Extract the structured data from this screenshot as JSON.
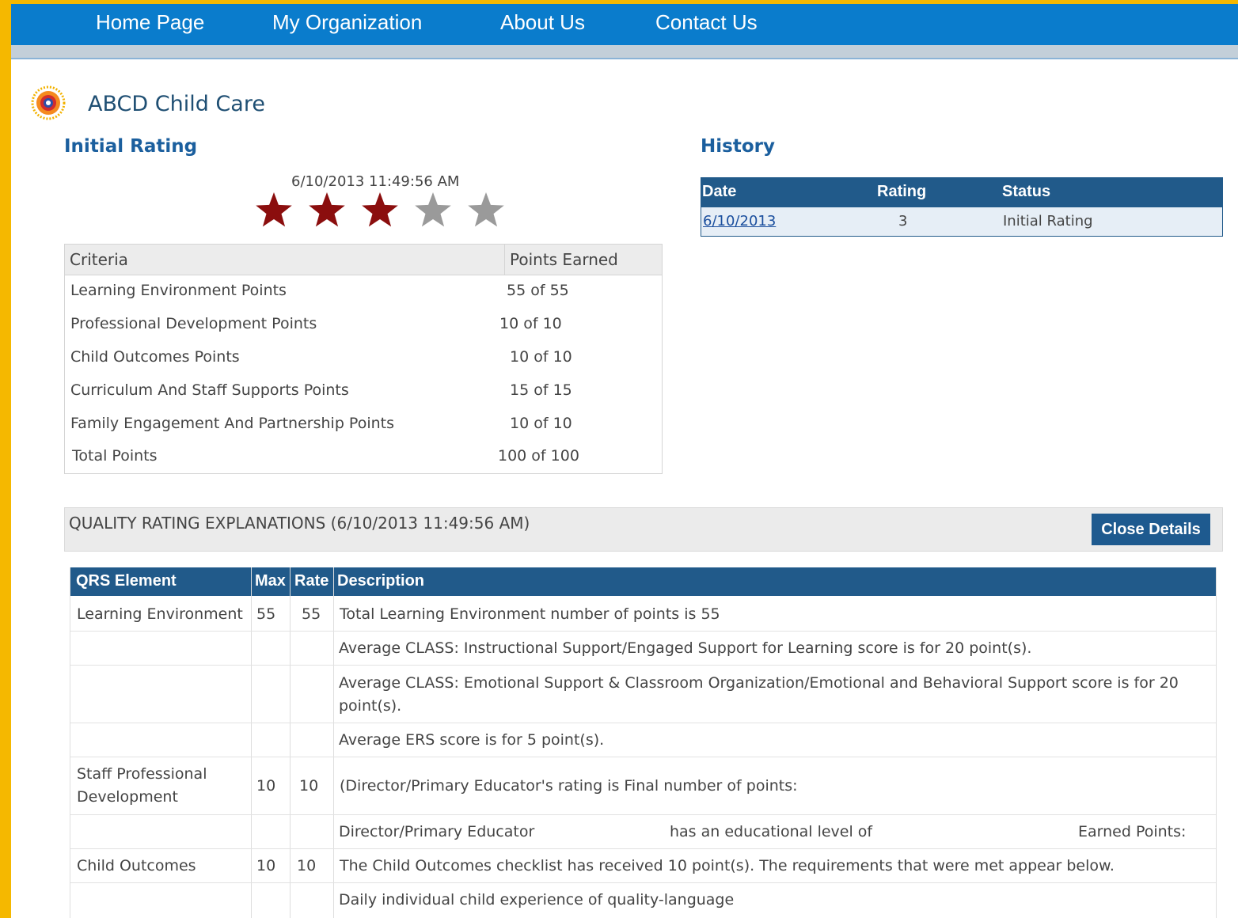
{
  "nav": {
    "items": [
      {
        "label": "Home Page"
      },
      {
        "label": "My Organization"
      },
      {
        "label": "About Us"
      },
      {
        "label": "Contact Us"
      }
    ]
  },
  "org": {
    "name": "ABCD Child Care"
  },
  "initial_rating": {
    "title": "Initial Rating",
    "timestamp": "6/10/2013 11:49:56 AM",
    "stars_filled": 3,
    "stars_total": 5,
    "star_filled_color": "#8b0e0e",
    "star_empty_color": "#9a9a9a",
    "criteria_header": "Criteria",
    "points_header": "Points Earned",
    "rows": [
      {
        "label": "Learning Environment Points",
        "value": "55 of 55"
      },
      {
        "label": "Professional Development Points",
        "value": "10 of 10"
      },
      {
        "label": "Child Outcomes Points",
        "value": "10 of 10"
      },
      {
        "label": "Curriculum And Staff Supports Points",
        "value": "15 of 15"
      },
      {
        "label": "Family Engagement And Partnership Points",
        "value": "10 of 10"
      },
      {
        "label": "Total Points",
        "value": "100 of 100"
      }
    ]
  },
  "history": {
    "title": "History",
    "headers": {
      "date": "Date",
      "rating": "Rating",
      "status": "Status"
    },
    "rows": [
      {
        "date": "6/10/2013",
        "rating": "3",
        "status": "Initial Rating"
      }
    ]
  },
  "explanations": {
    "title": "QUALITY RATING EXPLANATIONS (6/10/2013 11:49:56 AM)",
    "close_button": "Close Details",
    "headers": {
      "element": "QRS Element",
      "max": "Max",
      "rate": "Rate",
      "description": "Description"
    },
    "rows": [
      {
        "element": "Learning Environment",
        "max": "55",
        "rate": "55",
        "description": "Total Learning Environment number of points is 55"
      },
      {
        "element": "",
        "max": "",
        "rate": "",
        "description": "Average CLASS: Instructional Support/Engaged Support for Learning score is    for 20 point(s)."
      },
      {
        "element": "",
        "max": "",
        "rate": "",
        "description": "Average CLASS: Emotional Support & Classroom Organization/Emotional and Behavioral Support score is    for 20 point(s)."
      },
      {
        "element": "",
        "max": "",
        "rate": "",
        "description": "Average ERS score is        for 5 point(s)."
      },
      {
        "element": "Staff Professional Development",
        "max": "10",
        "rate": "10",
        "description": "(Director/Primary Educator's rating is    Final number of points:"
      },
      {
        "element": "",
        "max": "",
        "rate": "",
        "description_parts": [
          "Director/Primary Educator",
          "has an educational level of",
          "Earned Points:"
        ]
      },
      {
        "element": "Child Outcomes",
        "max": "10",
        "rate": "10",
        "description": "The Child Outcomes checklist has received 10 point(s). The requirements that were met appear below."
      },
      {
        "element": "",
        "max": "",
        "rate": "",
        "description": "Daily individual child experience of quality-language"
      }
    ]
  }
}
